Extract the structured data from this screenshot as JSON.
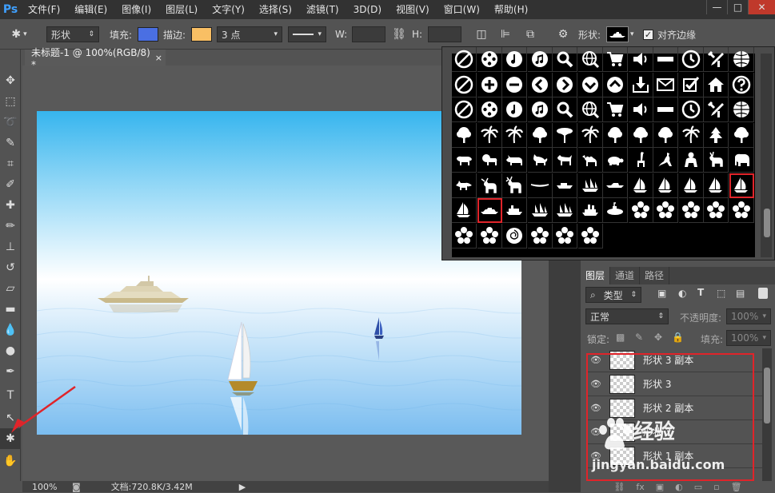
{
  "app": {
    "logo": "Ps"
  },
  "menu": [
    "文件(F)",
    "编辑(E)",
    "图像(I)",
    "图层(L)",
    "文字(Y)",
    "选择(S)",
    "滤镜(T)",
    "3D(D)",
    "视图(V)",
    "窗口(W)",
    "帮助(H)"
  ],
  "window_controls": [
    "—",
    "□",
    "✕"
  ],
  "options": {
    "mode_value": "形状",
    "fill_label": "填充:",
    "fill_color": "#4a6fe3",
    "stroke_label": "描边:",
    "stroke_color": "#f9bf64",
    "stroke_width_value": "3 点",
    "w_label": "W:",
    "h_label": "H:",
    "shape_label": "形状:",
    "align_edges_label": "对齐边缘",
    "align_edges_checked": true
  },
  "document": {
    "tab_title": "未标题-1 @ 100%(RGB/8) *",
    "tab_close": "×",
    "zoom": "100%",
    "doc_size": "文档:720.8K/3.42M"
  },
  "colors": {
    "accent_red": "#e0242a",
    "canvas_top": "#36b5ee",
    "canvas_bottom": "#7bbdf0"
  },
  "shape_picker": {
    "icons": [
      "no-symbol",
      "film-reel",
      "music-note",
      "music-notes",
      "magnifier",
      "globe-web",
      "cart",
      "speaker",
      "rectangle-bar",
      "clock",
      "tools",
      "globe",
      "no-symbol",
      "plus-circle",
      "minus-circle",
      "left-arrow-circle",
      "right-arrow-circle",
      "down-arrow-circle",
      "up-arrow-circle",
      "download-box",
      "envelope",
      "checkbox",
      "house",
      "question-circle",
      "no-symbol",
      "film-reel",
      "music-note",
      "music-notes",
      "magnifier",
      "globe-web",
      "cart",
      "speaker",
      "rectangle-bar",
      "clock",
      "tools",
      "globe",
      "tree",
      "palm-tree",
      "palm-tree",
      "tree",
      "acacia-tree",
      "palm-tree",
      "tree",
      "tree",
      "tree",
      "palm-tree",
      "pine-tree",
      "tree",
      "bull",
      "lion",
      "rhino",
      "cat",
      "dog",
      "camel",
      "turtle",
      "giraffe",
      "kangaroo",
      "gorilla",
      "deer",
      "elephant",
      "fox",
      "moose",
      "reindeer",
      "canoe",
      "boat",
      "tall-ship",
      "speedboat",
      "sailboat",
      "sailboat",
      "sailboat",
      "sailboat",
      "sailboat-selected",
      "sailboat",
      "yacht-selected",
      "ferry",
      "tall-ship",
      "tall-ship",
      "steamship",
      "submarine",
      "flower",
      "flower",
      "flower",
      "flower",
      "flower",
      "flower",
      "flower",
      "rose",
      "flower",
      "flower",
      "flower"
    ]
  },
  "layers_panel": {
    "tabs": [
      "图层",
      "通道",
      "路径"
    ],
    "filter_type": "类型",
    "blend_mode": "正常",
    "opacity_label": "不透明度:",
    "opacity_value": "100%",
    "lock_label": "锁定:",
    "fill_label": "填充:",
    "fill_value": "100%",
    "layers": [
      {
        "name": "形状 3 副本",
        "visible": true
      },
      {
        "name": "形状 3",
        "visible": true
      },
      {
        "name": "形状 2 副本",
        "visible": true
      },
      {
        "name": "形状 2",
        "visible": true
      },
      {
        "name": "形状 1 副本",
        "visible": true
      }
    ],
    "footer_icons": [
      "link-icon",
      "fx-icon",
      "mask-icon",
      "adjustment-icon",
      "folder-icon",
      "new-layer-icon",
      "trash-icon"
    ],
    "footer_glyphs": [
      "⛓",
      "fx",
      "▣",
      "◐",
      "▭",
      "▫",
      "🗑"
    ]
  },
  "watermark": {
    "text": "经验",
    "url": "jingyan.baidu.com"
  }
}
